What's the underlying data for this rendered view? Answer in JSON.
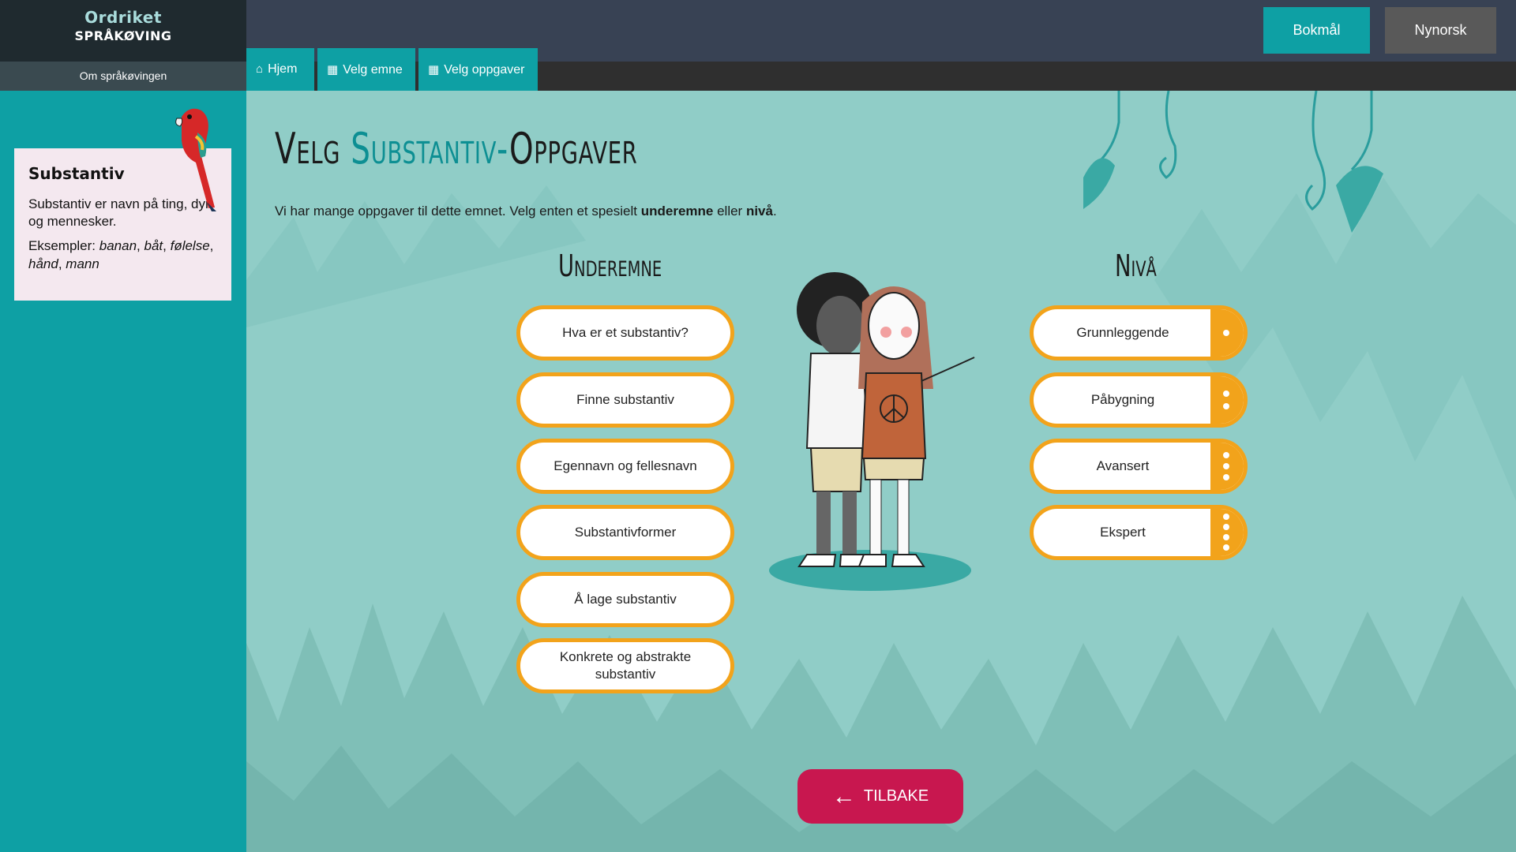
{
  "app": {
    "logo": "Ordriket",
    "subtitle": "SPRÅKØVING",
    "about_link": "Om språkøvingen"
  },
  "language": {
    "bokmal": "Bokmål",
    "nynorsk": "Nynorsk"
  },
  "nav": {
    "tabs": [
      {
        "label": "Hjem",
        "icon": "home-icon"
      },
      {
        "label": "Velg emne",
        "icon": "grid-icon"
      },
      {
        "label": "Velg oppgaver",
        "icon": "grid-icon"
      }
    ]
  },
  "sidebar": {
    "card_title": "Substantiv",
    "card_text": "Substantiv er navn på ting, dyr og mennesker.",
    "examples_label": "Eksempler:",
    "examples": [
      "banan",
      "båt",
      "følelse",
      "hånd",
      "mann"
    ]
  },
  "main": {
    "title_prefix": "Velg",
    "title_accent": "Substantiv-",
    "title_suffix": "Oppgaver",
    "intro_pre": "Vi har mange oppgaver til dette emnet. Velg enten et spesielt",
    "intro_bold1": "underemne",
    "intro_mid": "eller",
    "intro_bold2": "nivå",
    "intro_end": ".",
    "subtopics_heading": "Underemne",
    "subtopics": [
      "Hva er et substantiv?",
      "Finne substantiv",
      "Egennavn og fellesnavn",
      "Substantivformer",
      "Å lage substantiv",
      "Konkrete og abstrakte substantiv"
    ],
    "levels_heading": "Nivå",
    "levels": [
      {
        "label": "Grunnleggende",
        "dots": 1
      },
      {
        "label": "Påbygning",
        "dots": 2
      },
      {
        "label": "Avansert",
        "dots": 3
      },
      {
        "label": "Ekspert",
        "dots": 4
      }
    ],
    "back_label": "TILBAKE"
  },
  "colors": {
    "teal": "#0ea0a4",
    "orange": "#f2a31b",
    "back": "#c8174f",
    "topbar": "#384254"
  }
}
